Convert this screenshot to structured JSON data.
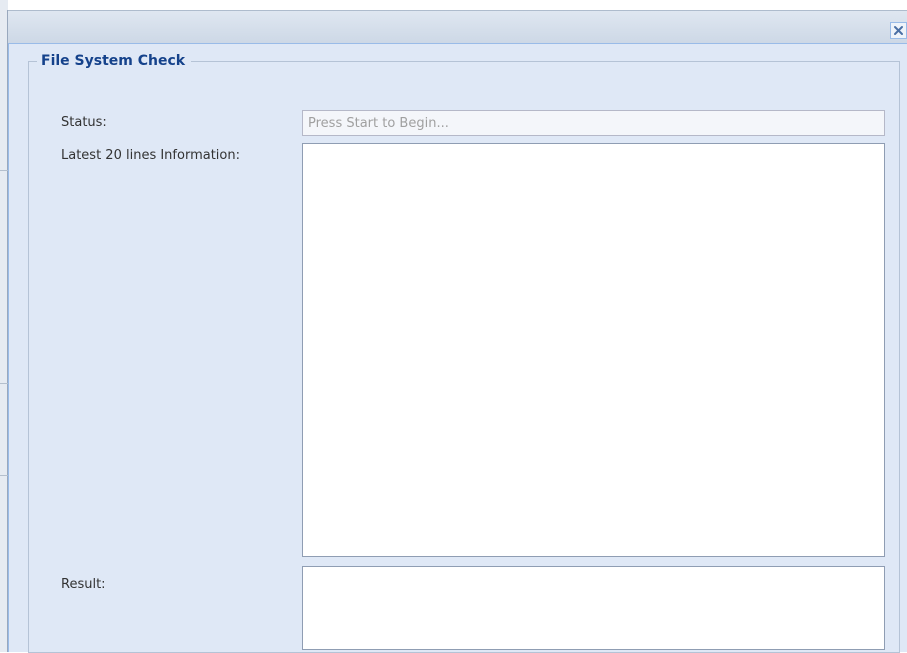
{
  "window": {
    "close_icon": "close-icon"
  },
  "form": {
    "legend": "File System Check",
    "status": {
      "label": "Status:",
      "value": "",
      "placeholder": "Press Start to Begin..."
    },
    "info": {
      "label": "Latest 20 lines Information:",
      "value": ""
    },
    "result": {
      "label": "Result:",
      "value": ""
    }
  },
  "colors": {
    "legend_text": "#15428b",
    "panel_background": "#dfe8f6",
    "border_accent": "#99bbe8"
  }
}
